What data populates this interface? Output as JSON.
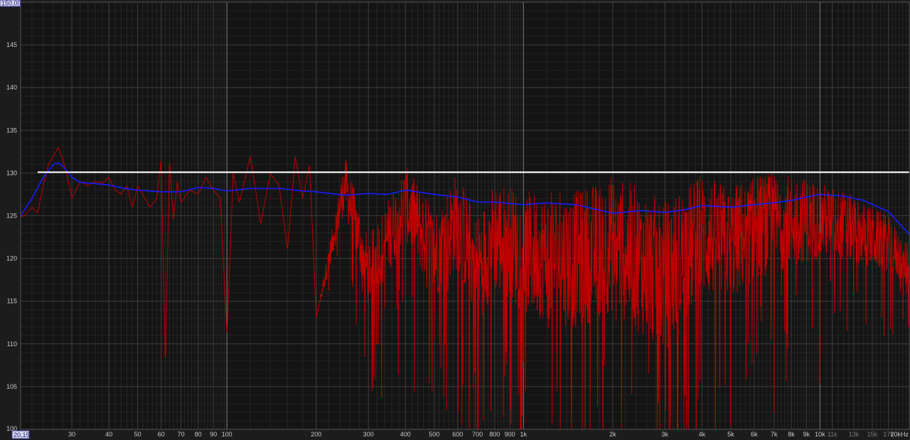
{
  "chart_data": {
    "type": "line",
    "title": "",
    "xlabel": "",
    "ylabel": "",
    "x_scale": "log",
    "xlim": [
      20.15,
      20000
    ],
    "ylim": [
      100,
      150
    ],
    "y_top_label": "150,00",
    "x_left_label": "20,15",
    "grid": true,
    "background_color": "#141414",
    "y_ticks": [
      {
        "value": 105,
        "label": "105"
      },
      {
        "value": 110,
        "label": "110"
      },
      {
        "value": 115,
        "label": "115"
      },
      {
        "value": 120,
        "label": "120"
      },
      {
        "value": 125,
        "label": "125"
      },
      {
        "value": 130,
        "label": "130"
      },
      {
        "value": 135,
        "label": "135"
      },
      {
        "value": 140,
        "label": "140"
      },
      {
        "value": 145,
        "label": "145"
      }
    ],
    "y_bottom_label": "100",
    "x_ticks": [
      {
        "value": 30,
        "label": "30",
        "minor": false
      },
      {
        "value": 40,
        "label": "40",
        "minor": false
      },
      {
        "value": 50,
        "label": "50",
        "minor": false
      },
      {
        "value": 60,
        "label": "60",
        "minor": false
      },
      {
        "value": 70,
        "label": "70",
        "minor": false
      },
      {
        "value": 80,
        "label": "80",
        "minor": false
      },
      {
        "value": 90,
        "label": "90",
        "minor": false
      },
      {
        "value": 100,
        "label": "100",
        "minor": false
      },
      {
        "value": 200,
        "label": "200",
        "minor": false
      },
      {
        "value": 300,
        "label": "300",
        "minor": false
      },
      {
        "value": 400,
        "label": "400",
        "minor": false
      },
      {
        "value": 500,
        "label": "500",
        "minor": false
      },
      {
        "value": 600,
        "label": "600",
        "minor": false
      },
      {
        "value": 700,
        "label": "700",
        "minor": false
      },
      {
        "value": 800,
        "label": "800",
        "minor": false
      },
      {
        "value": 900,
        "label": "900",
        "minor": false
      },
      {
        "value": 1000,
        "label": "1k",
        "minor": false
      },
      {
        "value": 2000,
        "label": "2k",
        "minor": false
      },
      {
        "value": 3000,
        "label": "3k",
        "minor": false
      },
      {
        "value": 4000,
        "label": "4k",
        "minor": false
      },
      {
        "value": 5000,
        "label": "5k",
        "minor": false
      },
      {
        "value": 6000,
        "label": "6k",
        "minor": false
      },
      {
        "value": 7000,
        "label": "7k",
        "minor": false
      },
      {
        "value": 8000,
        "label": "8k",
        "minor": false
      },
      {
        "value": 9000,
        "label": "9k",
        "minor": false
      },
      {
        "value": 10000,
        "label": "10k",
        "minor": false
      },
      {
        "value": 11000,
        "label": "11k",
        "minor": true
      },
      {
        "value": 13000,
        "label": "13k",
        "minor": true
      },
      {
        "value": 15000,
        "label": "15k",
        "minor": true
      },
      {
        "value": 17000,
        "label": "17k",
        "minor": true
      },
      {
        "value": 20000,
        "label": "20kHz",
        "minor": false
      }
    ],
    "series": [
      {
        "color": "#c00000",
        "style": "raw-noisy",
        "x": [
          20.15,
          21,
          22,
          23,
          24,
          25,
          26,
          27,
          28,
          29,
          30,
          32,
          34,
          36,
          38,
          40,
          42,
          44,
          46,
          48,
          50,
          52,
          55,
          58,
          60,
          62,
          64,
          66,
          68,
          70,
          75,
          80,
          85,
          90,
          95,
          100,
          105,
          110,
          120,
          130,
          140,
          150,
          160,
          170,
          180,
          190,
          200,
          250,
          300,
          400,
          500,
          600,
          700,
          800,
          1000,
          1500,
          2000,
          3000,
          4000,
          5000,
          6000,
          8000,
          10000,
          12000,
          15000,
          17000,
          20000
        ],
        "y": [
          124.8,
          125.2,
          126.0,
          125.3,
          128.5,
          131.0,
          132.0,
          133.0,
          131.5,
          129.5,
          127.0,
          129.0,
          128.5,
          129.0,
          128.8,
          129.5,
          128.0,
          127.5,
          128.5,
          126.0,
          128.5,
          127.5,
          126.0,
          127.0,
          131.5,
          107.5,
          131.5,
          124.5,
          129.0,
          126.5,
          128.0,
          127.5,
          129.5,
          128.0,
          127.0,
          111.0,
          130.0,
          126.5,
          132.0,
          124.0,
          130.0,
          128.5,
          121.0,
          132.0,
          127.0,
          131.0,
          113.0,
          128.5,
          118.0,
          126.0,
          120.0,
          124.0,
          118.0,
          122.0,
          120.0,
          119.0,
          121.0,
          117.0,
          122.0,
          121.0,
          123.0,
          124.0,
          124.0,
          123.5,
          122.0,
          121.5,
          118.5
        ],
        "spread": [
          0,
          0,
          0,
          0,
          0,
          0,
          0,
          0,
          0,
          0,
          0,
          0,
          0,
          0,
          0,
          0,
          0,
          0,
          0,
          0,
          0,
          0,
          0,
          0,
          0,
          0,
          0,
          0,
          0,
          0,
          0,
          0,
          0,
          0,
          0,
          0,
          0,
          0,
          0,
          0,
          0,
          0,
          0,
          0,
          0,
          0,
          0,
          7,
          9,
          10,
          12,
          13,
          14,
          15,
          16,
          18,
          18,
          20,
          16,
          15,
          14,
          12,
          10,
          9,
          8,
          7,
          6
        ]
      },
      {
        "color": "#1a1aff",
        "style": "smoothed",
        "x": [
          20.15,
          22,
          24,
          26,
          27,
          28,
          30,
          32,
          35,
          40,
          45,
          50,
          60,
          70,
          80,
          90,
          100,
          120,
          150,
          180,
          200,
          250,
          300,
          350,
          400,
          500,
          600,
          700,
          800,
          1000,
          1200,
          1500,
          2000,
          2500,
          3000,
          3500,
          4000,
          5000,
          6000,
          7000,
          8000,
          10000,
          12000,
          14000,
          17000,
          20000
        ],
        "y": [
          125.0,
          127.0,
          129.5,
          131.0,
          131.2,
          130.8,
          129.5,
          128.9,
          128.8,
          128.6,
          128.2,
          128.0,
          127.8,
          127.8,
          128.3,
          128.2,
          127.9,
          128.2,
          128.2,
          127.9,
          127.8,
          127.4,
          127.6,
          127.5,
          128.0,
          127.5,
          127.2,
          126.6,
          126.6,
          126.3,
          126.5,
          126.3,
          125.3,
          125.6,
          125.4,
          125.7,
          126.2,
          126.0,
          126.3,
          126.5,
          126.8,
          127.5,
          127.3,
          126.8,
          125.5,
          122.8
        ]
      },
      {
        "color": "#ffffff",
        "style": "reference",
        "x": [
          23,
          20000
        ],
        "y": [
          130.1,
          130.1
        ]
      }
    ]
  }
}
